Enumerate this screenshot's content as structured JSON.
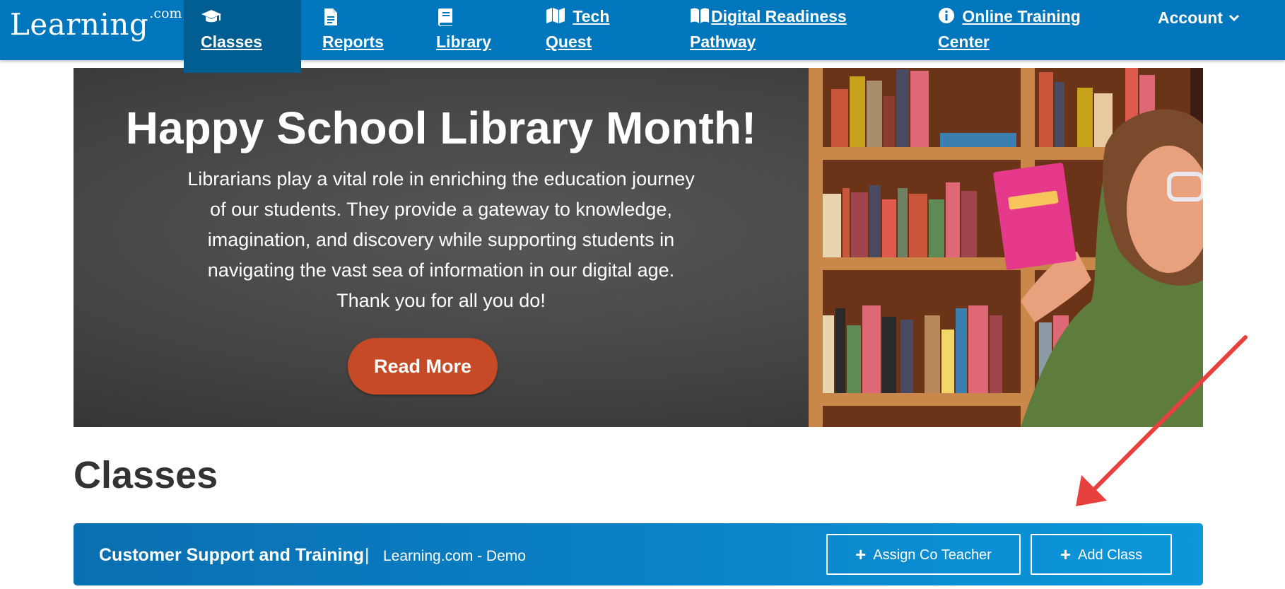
{
  "nav": {
    "logo_main": "Learning",
    "logo_sup": ".com",
    "items": [
      {
        "label": "Classes",
        "icon": "graduation-cap-icon"
      },
      {
        "label": "Reports",
        "icon": "document-icon"
      },
      {
        "label": "Library",
        "icon": "book-icon"
      },
      {
        "label_line1": "Tech",
        "label_line2": "Quest",
        "icon": "map-icon"
      },
      {
        "label_line1": "Digital Readiness",
        "label_line2": "Pathway",
        "icon": "open-book-icon"
      },
      {
        "label_line1": "Online Training",
        "label_line2": "Center",
        "icon": "info-circle-icon"
      }
    ],
    "account_label": "Account",
    "account_icon": "chevron-down-icon"
  },
  "banner": {
    "title": "Happy School Library Month!",
    "body_lines": [
      "Librarians play a vital role in enriching the education journey",
      "of our students. They provide a gateway to knowledge,",
      "imagination, and discovery while supporting students in",
      "navigating the vast sea of information in our digital age.",
      "Thank you for all you do!"
    ],
    "button_label": "Read More"
  },
  "page": {
    "title": "Classes"
  },
  "class_bar": {
    "name": "Customer Support and Training",
    "separator": "|",
    "org": "Learning.com - Demo",
    "assign_button": "Assign Co Teacher",
    "add_button": "Add Class",
    "plus_icon": "plus-icon"
  },
  "colors": {
    "nav_bg": "#0077bd",
    "nav_active_bg": "#005e92",
    "read_more_bg": "#c54a25",
    "class_bar_start": "#0a6fb0",
    "class_bar_end": "#0c97db",
    "annotation_arrow": "#e8403d"
  }
}
